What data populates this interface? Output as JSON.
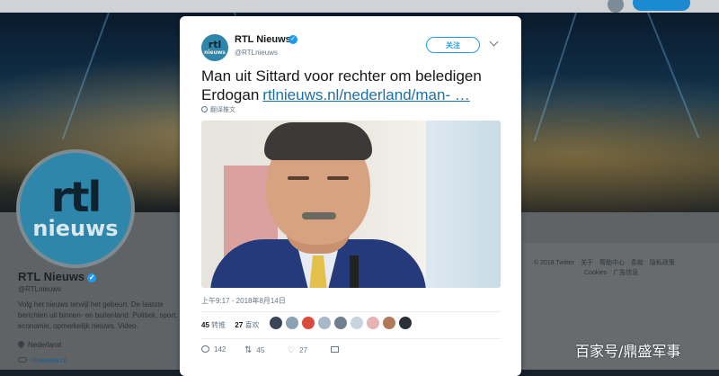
{
  "background_profile": {
    "logo_rtl": "rtl",
    "logo_nieuws": "nieuws",
    "name": "RTL Nieuws",
    "handle": "@RTLnieuws",
    "bio": "Volg het nieuws terwijl het gebeurt. De laatste berichten uit binnen- en buitenland. Politiek, sport, economie, opmerkelijk nieuws. Video.",
    "location": "Nederland",
    "url": "rtlnieuws.nl",
    "footer_links": [
      "© 2018 Twitter",
      "关于",
      "帮助中心",
      "条款",
      "隐私政策",
      "Cookies",
      "广告信息"
    ]
  },
  "tweet": {
    "avatar_rtl": "rtl",
    "avatar_nieuws": "nieuws",
    "author_name": "RTL Nieuws",
    "verified_mark": "✓",
    "author_handle": "@RTLnieuws",
    "follow_label": "关注",
    "text": "Man uit Sittard voor rechter om beledigen Erdogan",
    "link_text": "rtlnieuws.nl/nederland/man- …",
    "translate_label": "翻译推文",
    "timestamp": "上午9:17 - 2018年8月14日",
    "retweets_count": "45",
    "retweets_label": "转推",
    "likes_count": "27",
    "likes_label": "喜欢",
    "liker_colors": [
      "#3a4656",
      "#8aa0b3",
      "#d94b3c",
      "#a7b8c9",
      "#6f7f8f",
      "#c8d4df",
      "#e6b3b3",
      "#b07a5a",
      "#2b2f36"
    ],
    "actions": {
      "reply_count": "142",
      "retweet_count": "45",
      "like_count": "27"
    }
  },
  "watermark": "百家号/鼎盛军事"
}
